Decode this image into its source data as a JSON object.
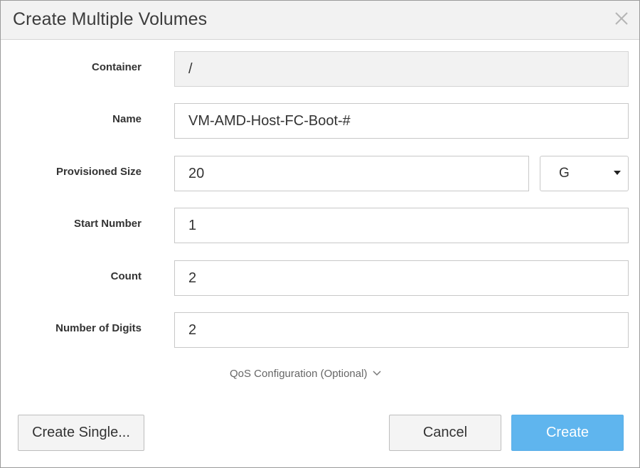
{
  "dialog": {
    "title": "Create Multiple Volumes",
    "close_icon": "close-icon"
  },
  "form": {
    "container": {
      "label": "Container",
      "value": "/"
    },
    "name": {
      "label": "Name",
      "value": "VM-AMD-Host-FC-Boot-#"
    },
    "provisioned_size": {
      "label": "Provisioned Size",
      "value": "20",
      "unit": "G"
    },
    "start_number": {
      "label": "Start Number",
      "value": "1"
    },
    "count": {
      "label": "Count",
      "value": "2"
    },
    "number_of_digits": {
      "label": "Number of Digits",
      "value": "2"
    }
  },
  "qos": {
    "label": "QoS Configuration (Optional)",
    "icon": "chevron-down-icon"
  },
  "buttons": {
    "create_single": "Create Single...",
    "cancel": "Cancel",
    "create": "Create"
  },
  "colors": {
    "primary": "#5fb5ee",
    "header_bg": "#f2f2f2",
    "readonly_bg": "#f2f2f2"
  }
}
